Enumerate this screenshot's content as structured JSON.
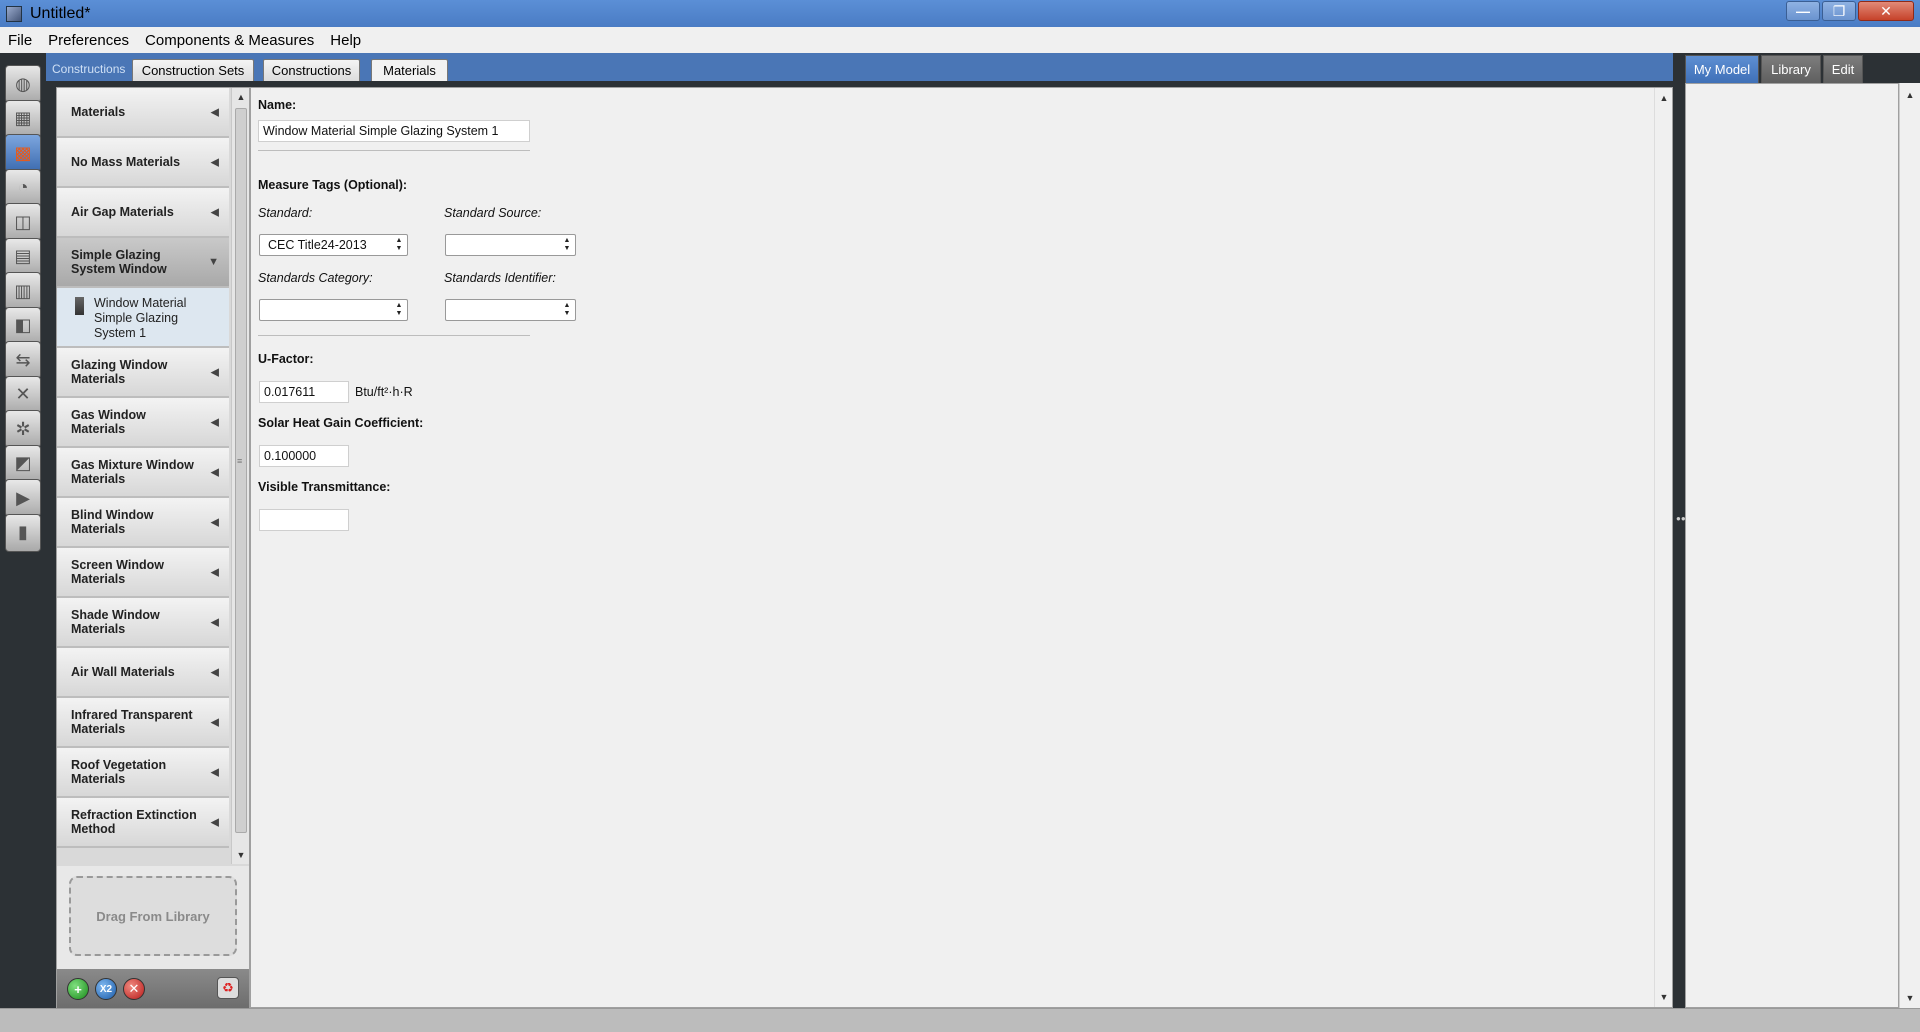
{
  "window": {
    "title": "Untitled*",
    "minimize": "—",
    "maximize": "❐",
    "close": "✕"
  },
  "menu": [
    "File",
    "Preferences",
    "Components & Measures",
    "Help"
  ],
  "tabs": {
    "section_label": "Constructions",
    "items": [
      "Construction Sets",
      "Constructions",
      "Materials"
    ],
    "active": "Materials"
  },
  "left_tools": [
    {
      "name": "site-icon",
      "glyph": "◍"
    },
    {
      "name": "schedules-icon",
      "glyph": "▦"
    },
    {
      "name": "constructions-icon",
      "glyph": "▩"
    },
    {
      "name": "loads-icon",
      "glyph": "◔"
    },
    {
      "name": "space-types-icon",
      "glyph": "◫"
    },
    {
      "name": "geometry-icon",
      "glyph": "▤"
    },
    {
      "name": "facility-icon",
      "glyph": "▥"
    },
    {
      "name": "spaces-icon",
      "glyph": "◧"
    },
    {
      "name": "thermal-zones-icon",
      "glyph": "⇆"
    },
    {
      "name": "hvac-systems-icon",
      "glyph": "✕"
    },
    {
      "name": "building-summary-icon",
      "glyph": "✲"
    },
    {
      "name": "output-variables-icon",
      "glyph": "◩"
    },
    {
      "name": "run-simulation-icon",
      "glyph": "▶"
    },
    {
      "name": "results-summary-icon",
      "glyph": "▮"
    }
  ],
  "material_categories": [
    {
      "label": "Materials",
      "expanded": false
    },
    {
      "label": "No Mass Materials",
      "expanded": false
    },
    {
      "label": "Air Gap Materials",
      "expanded": false
    },
    {
      "label": "Simple Glazing System Window",
      "expanded": true
    },
    {
      "label": "Glazing Window Materials",
      "expanded": false
    },
    {
      "label": "Gas Window Materials",
      "expanded": false
    },
    {
      "label": "Gas Mixture Window Materials",
      "expanded": false
    },
    {
      "label": "Blind Window Materials",
      "expanded": false
    },
    {
      "label": "Screen Window Materials",
      "expanded": false
    },
    {
      "label": "Shade Window Materials",
      "expanded": false
    },
    {
      "label": "Air Wall Materials",
      "expanded": false
    },
    {
      "label": "Infrared Transparent Materials",
      "expanded": false
    },
    {
      "label": "Roof Vegetation Materials",
      "expanded": false
    },
    {
      "label": "Refraction Extinction Method",
      "expanded": false
    }
  ],
  "expanded_item": "Window Material Simple Glazing System 1",
  "drop_zone": "Drag From Library",
  "bottom_buttons": {
    "add": "+",
    "copy": "X2",
    "delete": "✕",
    "purge": "♻"
  },
  "inspector": {
    "name_label": "Name:",
    "name_value": "Window Material Simple Glazing System 1",
    "measure_tags_label": "Measure Tags (Optional):",
    "standard_label": "Standard:",
    "standard_value": "CEC Title24-2013",
    "standard_source_label": "Standard Source:",
    "standard_source_value": "",
    "standards_category_label": "Standards Category:",
    "standards_category_value": "",
    "standards_identifier_label": "Standards Identifier:",
    "standards_identifier_value": "",
    "u_factor_label": "U-Factor:",
    "u_factor_value": "0.017611",
    "u_factor_units": "Btu/ft²·h·R",
    "shgc_label": "Solar Heat Gain Coefficient:",
    "shgc_value": "0.100000",
    "vt_label": "Visible Transmittance:",
    "vt_value": ""
  },
  "right_tabs": [
    "My Model",
    "Library",
    "Edit"
  ],
  "right_active": "My Model",
  "scroll_glyphs": {
    "up": "▲",
    "down": "▼",
    "spin_up": "▲",
    "spin_down": "▼",
    "grip": "≡",
    "dots": "●●●"
  }
}
